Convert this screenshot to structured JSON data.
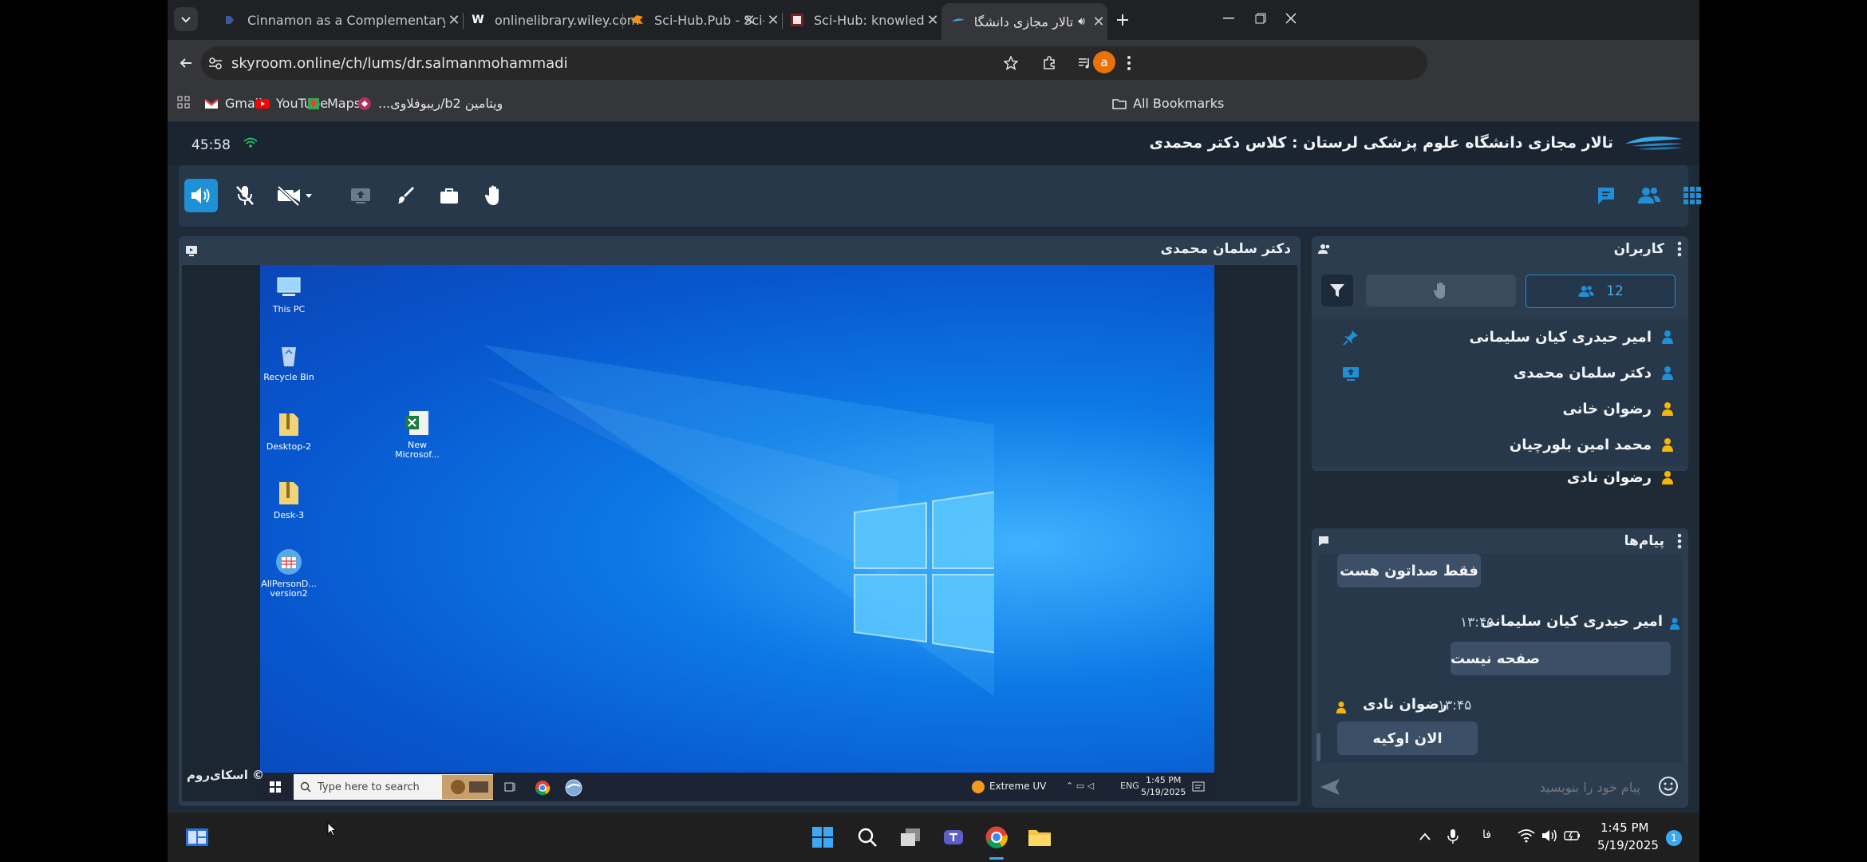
{
  "browser": {
    "tabs": [
      {
        "title": "Cinnamon as a Complementary",
        "favicon": "document-icon"
      },
      {
        "title": "onlinelibrary.wiley.com",
        "favicon": "W"
      },
      {
        "title": "Sci-Hub.Pub - Sci-Hub Availabl",
        "favicon": "bird-icon"
      },
      {
        "title": "Sci-Hub: knowledge as a human",
        "favicon": "scihub-icon"
      },
      {
        "title": "تالار مجازی دانشگاه علوم پزشک",
        "favicon": "skyroom-icon",
        "active": true
      }
    ],
    "url": "skyroom.online/ch/lums/dr.salmanmohammadi",
    "profile_initial": "a",
    "bookmarks": [
      {
        "label": "Gmail"
      },
      {
        "label": "YouTube"
      },
      {
        "label": "Maps"
      },
      {
        "label": "ویتامین b2/ریبوفلاوی..."
      }
    ],
    "all_bookmarks": "All Bookmarks"
  },
  "app": {
    "timer": "45:58",
    "title": "تالار مجازی دانشگاه علوم پزشکی لرستان : کلاس دکتر محمدی",
    "accent_color": "#1f8fd6",
    "presenter": "دکتر سلمان محمدی",
    "watermark": "© اسکای‌روم",
    "users_panel": {
      "title": "کاربران",
      "count": "12",
      "users": [
        {
          "name": "امیر حیدری کیان سلیمانی",
          "role": "admin",
          "badge": "pin-icon"
        },
        {
          "name": "دکتر سلمان محمدی",
          "role": "admin",
          "badge": "screen-share-icon"
        },
        {
          "name": "رضوان خانی",
          "role": "guest"
        },
        {
          "name": "محمد امین بلورچیان",
          "role": "guest"
        },
        {
          "name": "رضوان نادی",
          "role": "guest"
        }
      ]
    },
    "messages_panel": {
      "title": "پیام‌ها",
      "messages": [
        {
          "text": "فقط صداتون هست"
        },
        {
          "sender": "امیر حیدری کیان سلیمانی",
          "time": "۱۳:۴۵",
          "text": "صفحه نیست"
        },
        {
          "sender": "رضوان نادی",
          "time": "۱۳:۴۵",
          "text": "الان اوکیه"
        }
      ],
      "input_placeholder": "پیام خود را بنویسید"
    }
  },
  "shared_screen": {
    "desktop_icons": [
      {
        "label": "This PC"
      },
      {
        "label": "Recycle Bin"
      },
      {
        "label": "Desktop-2"
      },
      {
        "label": "Desk-3"
      },
      {
        "label": "AllPersonD... version2"
      },
      {
        "label": "New Microsof..."
      }
    ],
    "taskbar_search": "Type here to search",
    "weather": "Extreme UV",
    "lang": "ENG",
    "time": "1:45 PM",
    "date": "5/19/2025"
  },
  "os_taskbar": {
    "lang": "فا",
    "time": "1:45 PM",
    "date": "5/19/2025",
    "notifications": "1"
  }
}
